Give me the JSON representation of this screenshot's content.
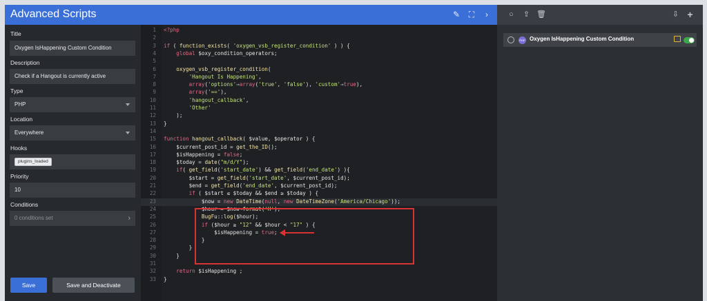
{
  "header": {
    "title": "Advanced Scripts"
  },
  "form": {
    "title_label": "Title",
    "title_value": "Oxygen IsHappening Custom Condition",
    "description_label": "Description",
    "description_value": "Check if a Hangout is currently active",
    "type_label": "Type",
    "type_value": "PHP",
    "location_label": "Location",
    "location_value": "Everywhere",
    "hooks_label": "Hooks",
    "hooks_chip": "plugins_loaded",
    "priority_label": "Priority",
    "priority_value": "10",
    "conditions_label": "Conditions",
    "conditions_value": "0 conditions set",
    "save_label": "Save",
    "save_deactivate_label": "Save and Deactivate"
  },
  "editor": {
    "lines": [
      {
        "n": "1",
        "t": "<?php"
      },
      {
        "n": "2",
        "t": ""
      },
      {
        "n": "3",
        "t": "if ( function_exists( 'oxygen_vsb_register_condition' ) ) {"
      },
      {
        "n": "4",
        "t": "    global $oxy_condition_operators;"
      },
      {
        "n": "5",
        "t": ""
      },
      {
        "n": "6",
        "t": "    oxygen_vsb_register_condition("
      },
      {
        "n": "7",
        "t": "        'Hangout Is Happening',"
      },
      {
        "n": "8",
        "t": "        array('options'⇒array('true', 'false'), 'custom'⇒true),"
      },
      {
        "n": "9",
        "t": "        array('=='),"
      },
      {
        "n": "10",
        "t": "        'hangout_callback',"
      },
      {
        "n": "11",
        "t": "        'Other'"
      },
      {
        "n": "12",
        "t": "    );"
      },
      {
        "n": "13",
        "t": "}"
      },
      {
        "n": "14",
        "t": ""
      },
      {
        "n": "15",
        "t": "function hangout_callback( $value, $operator ) {"
      },
      {
        "n": "16",
        "t": "    $current_post_id = get_the_ID();"
      },
      {
        "n": "17",
        "t": "    $isHappening = false;"
      },
      {
        "n": "18",
        "t": "    $today = date(\"m/d/Y\");"
      },
      {
        "n": "19",
        "t": "    if( get_field('start_date') && get_field('end_date') ){"
      },
      {
        "n": "20",
        "t": "        $start = get_field('start_date', $current_post_id);"
      },
      {
        "n": "21",
        "t": "        $end = get_field('end_date', $current_post_id);"
      },
      {
        "n": "22",
        "t": "        if ( $start ≤ $today && $end ≥ $today ) {"
      },
      {
        "n": "23",
        "t": "            $now = new DateTime(null, new DateTimeZone('America/Chicago'));"
      },
      {
        "n": "24",
        "t": "            $hour = $now→format('H');"
      },
      {
        "n": "25",
        "t": "            BugFu::log($hour);"
      },
      {
        "n": "26",
        "t": "            if ($hour ≥ \"12\" && $hour < \"17\" ) {"
      },
      {
        "n": "27",
        "t": "                $isHappening = true;"
      },
      {
        "n": "28",
        "t": "            }"
      },
      {
        "n": "29",
        "t": "        }"
      },
      {
        "n": "30",
        "t": "    }"
      },
      {
        "n": "31",
        "t": ""
      },
      {
        "n": "32",
        "t": "    return $isHappening ;"
      },
      {
        "n": "33",
        "t": "}"
      }
    ],
    "active_line": "23"
  },
  "scripts_panel": {
    "items": [
      {
        "name": "Oxygen IsHappening Custom Condition",
        "badge": "PHP",
        "enabled": true
      }
    ]
  },
  "icons": {
    "edit": "pencil-icon",
    "fullscreen": "expand-icon",
    "collapse": "chevron-right-icon",
    "select": "circle-icon",
    "export": "export-icon",
    "delete": "trash-icon",
    "import": "import-icon",
    "add": "plus-icon"
  },
  "colors": {
    "accent": "#3a6fd8",
    "highlight_box": "#d83434",
    "toggle_on": "#3fa74b"
  }
}
